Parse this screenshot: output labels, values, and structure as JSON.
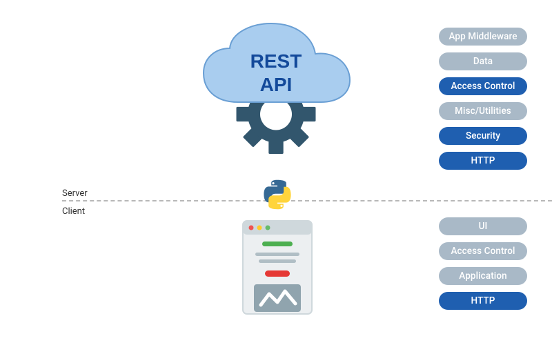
{
  "cloud_label": "REST\nAPI",
  "divider": {
    "server_label": "Server",
    "client_label": "Client"
  },
  "server_pills": [
    {
      "label": "App Middleware",
      "variant": "light"
    },
    {
      "label": "Data",
      "variant": "light"
    },
    {
      "label": "Access Control",
      "variant": "dark"
    },
    {
      "label": "Misc/Utilities",
      "variant": "light"
    },
    {
      "label": "Security",
      "variant": "dark"
    },
    {
      "label": "HTTP",
      "variant": "dark"
    }
  ],
  "client_pills": [
    {
      "label": "UI",
      "variant": "light"
    },
    {
      "label": "Access Control",
      "variant": "light"
    },
    {
      "label": "Application",
      "variant": "light"
    },
    {
      "label": "HTTP",
      "variant": "dark"
    }
  ],
  "icons": {
    "cloud": "cloud-icon",
    "gear": "gear-icon",
    "python": "python-icon",
    "browser": "browser-window-icon"
  },
  "colors": {
    "cloud_fill": "#a9cdef",
    "cloud_stroke": "#6a9fd4",
    "gear": "#32566d",
    "cloud_text": "#13499A",
    "pill_light": "#a9b9c7",
    "pill_dark": "#1f5fb0",
    "divider": "#b8b8b8",
    "python_blue": "#366994",
    "python_yellow": "#ffd43b",
    "browser_bg": "#eceff1",
    "browser_bar": "#cfd8dc",
    "browser_green": "#4caf50",
    "browser_red": "#e53935",
    "browser_footer": "#90a4ae"
  }
}
